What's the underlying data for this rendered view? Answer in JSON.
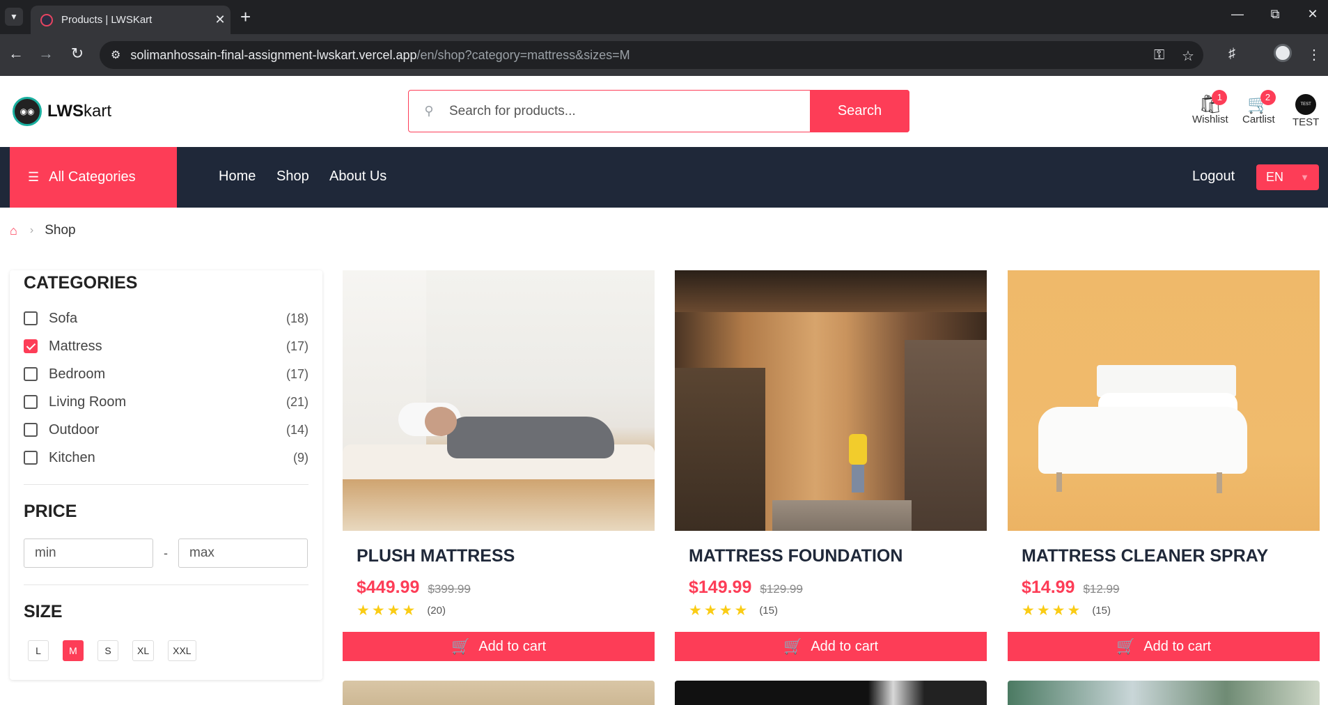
{
  "browser": {
    "tab_title": "Products | LWSKart",
    "url_host": "solimanhossain-final-assignment-lwskart.vercel.app",
    "url_path": "/en/shop?category=mattress&sizes=M"
  },
  "header": {
    "logo_bold": "LWS",
    "logo_light": "kart",
    "search_placeholder": "Search for products...",
    "search_button": "Search",
    "wishlist_label": "Wishlist",
    "wishlist_count": "1",
    "cartlist_label": "Cartlist",
    "cartlist_count": "2",
    "avatar_text": "TEST",
    "user_label": "TEST"
  },
  "nav": {
    "all_categories": "All Categories",
    "links": [
      "Home",
      "Shop",
      "About Us"
    ],
    "logout": "Logout",
    "language": "EN"
  },
  "breadcrumb": {
    "current": "Shop"
  },
  "sidebar": {
    "categories_title": "CATEGORIES",
    "categories": [
      {
        "label": "Sofa",
        "count": "(18)",
        "checked": false
      },
      {
        "label": "Mattress",
        "count": "(17)",
        "checked": true
      },
      {
        "label": "Bedroom",
        "count": "(17)",
        "checked": false
      },
      {
        "label": "Living Room",
        "count": "(21)",
        "checked": false
      },
      {
        "label": "Outdoor",
        "count": "(14)",
        "checked": false
      },
      {
        "label": "Kitchen",
        "count": "(9)",
        "checked": false
      }
    ],
    "price_title": "PRICE",
    "price_min_placeholder": "min",
    "price_max_placeholder": "max",
    "price_separator": "-",
    "size_title": "SIZE",
    "sizes": [
      "L",
      "M",
      "S",
      "XL",
      "XXL"
    ],
    "selected_size": "M"
  },
  "products": [
    {
      "title": "PLUSH MATTRESS",
      "price": "$449.99",
      "old_price": "$399.99",
      "rating": 4,
      "reviews": "(20)",
      "button": "Add to cart"
    },
    {
      "title": "MATTRESS FOUNDATION",
      "price": "$149.99",
      "old_price": "$129.99",
      "rating": 4,
      "reviews": "(15)",
      "button": "Add to cart"
    },
    {
      "title": "MATTRESS CLEANER SPRAY",
      "price": "$14.99",
      "old_price": "$12.99",
      "rating": 4,
      "reviews": "(15)",
      "button": "Add to cart"
    }
  ],
  "colors": {
    "accent": "#fd3d57",
    "navbar": "#1f2839",
    "star": "#facc15"
  }
}
